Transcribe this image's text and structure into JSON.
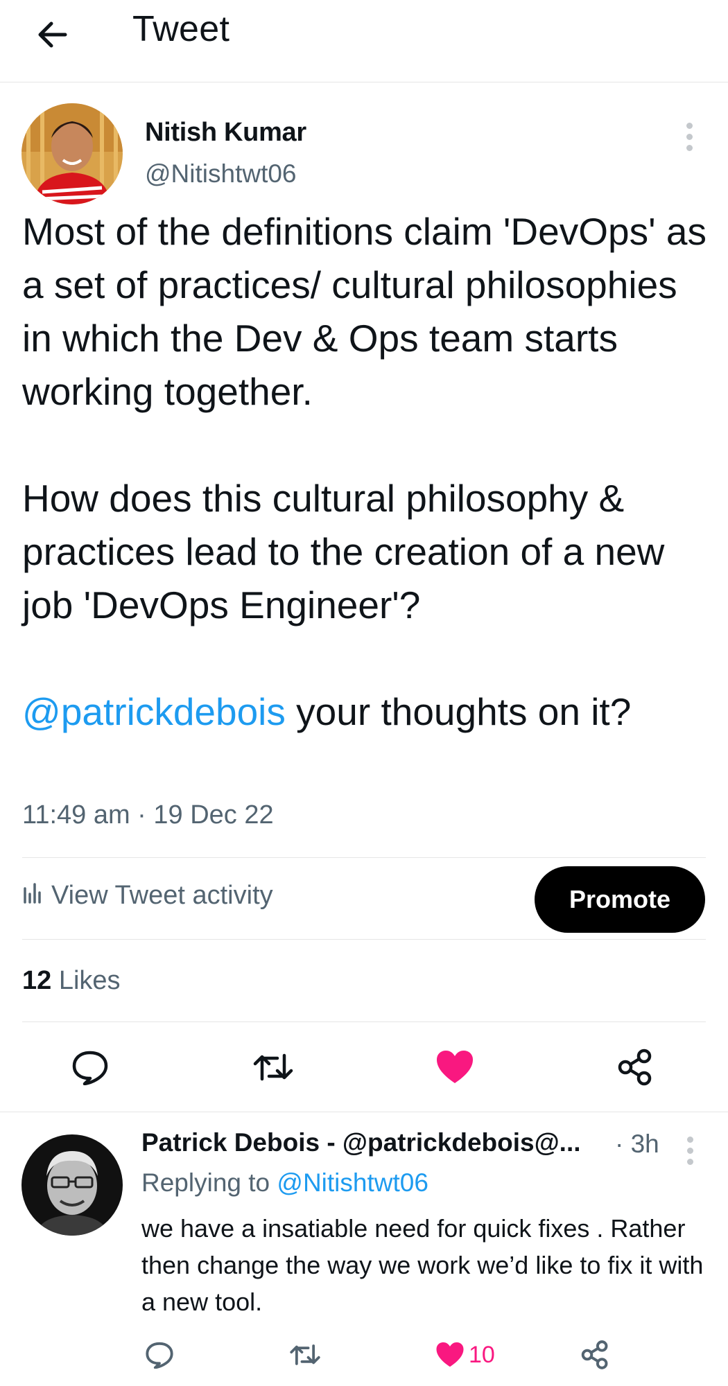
{
  "header": {
    "title": "Tweet"
  },
  "tweet": {
    "author_name": "Nitish Kumar",
    "author_handle": "@Nitishtwt06",
    "paragraph1": "Most of the definitions claim 'DevOps' as a set of practices/ cultural philosophies in which the Dev & Ops team starts working together.",
    "paragraph2": "How does this cultural philosophy & practices lead to the creation of a new job 'DevOps Engineer'?",
    "mention": "@patrickdebois",
    "paragraph3_rest": " your thoughts on it?",
    "timestamp": "11:49 am · 19 Dec 22",
    "activity_label": "View Tweet activity",
    "promote_label": "Promote",
    "likes_count": "12",
    "likes_label": "Likes"
  },
  "reply": {
    "author": "Patrick Debois - @patrickdebois@...",
    "time": "· 3h",
    "replying_prefix": "Replying to",
    "replying_handle": "@Nitishtwt06",
    "text": "we have a insatiable need for quick fixes . Rather then change the way we work we’d like to fix it with a new tool.",
    "like_count": "10"
  },
  "colors": {
    "accent": "#1d9bf0",
    "like": "#f91880",
    "muted": "#536471",
    "text": "#0f1419"
  },
  "icons": [
    "back-arrow-icon",
    "more-vertical-icon",
    "bar-chart-icon",
    "reply-icon",
    "retweet-icon",
    "heart-icon",
    "share-icon"
  ]
}
